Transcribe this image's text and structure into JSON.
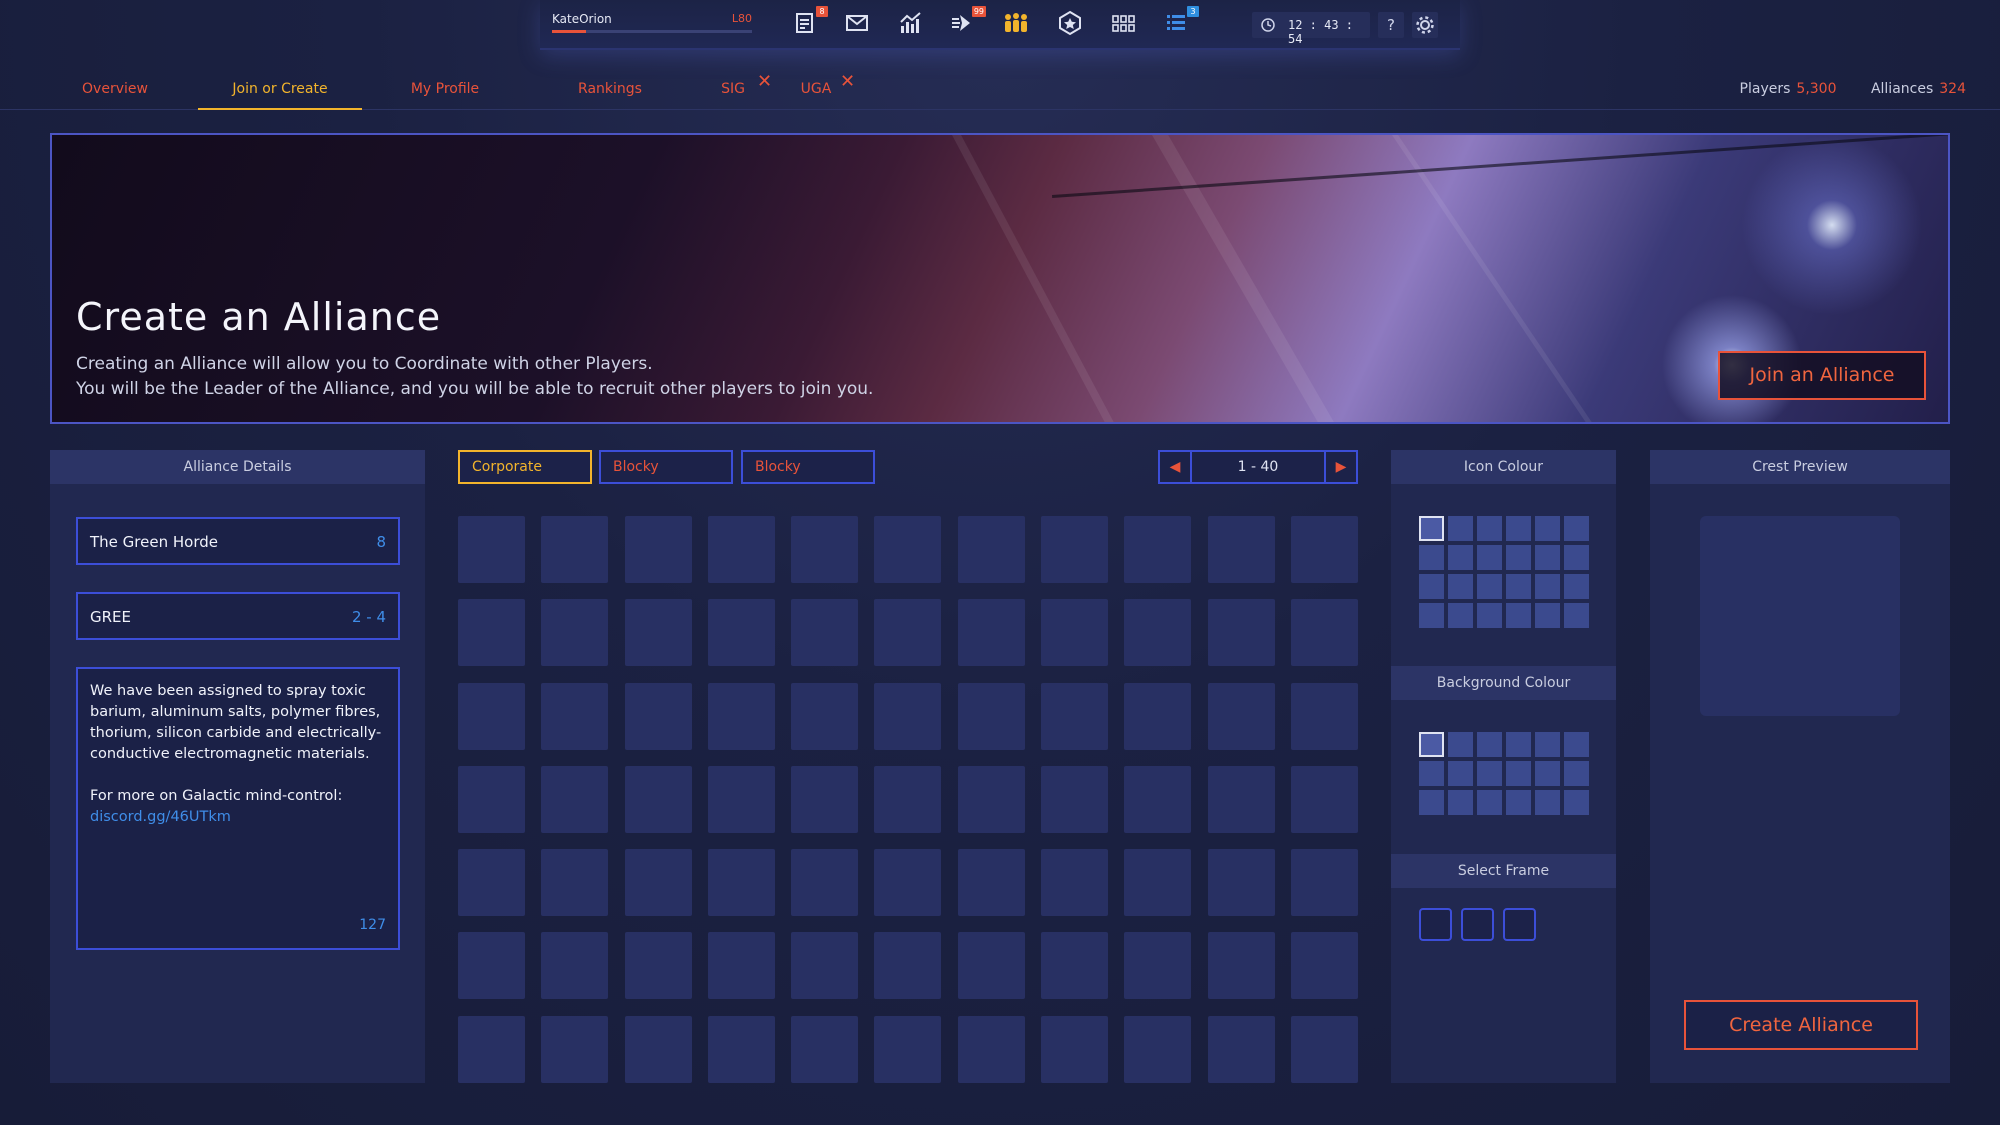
{
  "user": {
    "name": "KateOrion",
    "level": "L80",
    "xp_fraction": 0.17
  },
  "toolbar": {
    "icons": [
      {
        "name": "reports-icon",
        "badge": "8"
      },
      {
        "name": "mail-icon",
        "badge": ""
      },
      {
        "name": "stats-chart-icon",
        "badge": ""
      },
      {
        "name": "fleet-movement-icon",
        "badge": "99"
      },
      {
        "name": "alliance-members-icon",
        "badge": ""
      },
      {
        "name": "badge-star-icon",
        "badge": ""
      },
      {
        "name": "grid-menu-icon",
        "badge": ""
      },
      {
        "name": "queue-list-icon",
        "badge": "3"
      }
    ],
    "clock": "12 : 43 : 54",
    "help_label": "?"
  },
  "nav": {
    "tabs": [
      "Overview",
      "Join or Create",
      "My Profile",
      "Rankings",
      "SIG",
      "UGA"
    ],
    "active_index": 1,
    "close_glyph": "✕",
    "players_label": "Players",
    "players_value": "5,300",
    "alliances_label": "Alliances",
    "alliances_value": "324"
  },
  "banner": {
    "title": "Create an Alliance",
    "line1": "Creating an Alliance will allow you to Coordinate with other Players.",
    "line2": "You will be the Leader of the Alliance, and you will be able to recruit other players to join you.",
    "join_button": "Join an Alliance"
  },
  "details": {
    "header": "Alliance Details",
    "name_value": "The Green Horde",
    "name_count": "8",
    "tag_value": "GREE",
    "tag_range": "2 - 4",
    "description_p1": "We have been assigned to spray toxic barium, aluminum salts, polymer fibres, thorium, silicon carbide and electrically-conductive electromagnetic materials.",
    "description_p2": "For more on Galactic mind-control:",
    "description_link": "discord.gg/46UTkm",
    "description_count": "127"
  },
  "icon_styles": {
    "buttons": [
      "Corporate",
      "Blocky",
      "Blocky"
    ],
    "active_index": 0,
    "page_range": "1 - 40",
    "cell_count": 77
  },
  "colours": {
    "icon_header": "Icon Colour",
    "background_header": "Background Colour",
    "frame_header": "Select Frame",
    "icon_swatch_count": 24,
    "background_swatch_count": 18,
    "frame_count": 3
  },
  "crest": {
    "header": "Crest Preview",
    "create_button": "Create Alliance"
  },
  "colors": {
    "accent": "#e8533a",
    "active": "#f2b42c",
    "border": "#3c4ed8",
    "link": "#3f8de8"
  }
}
